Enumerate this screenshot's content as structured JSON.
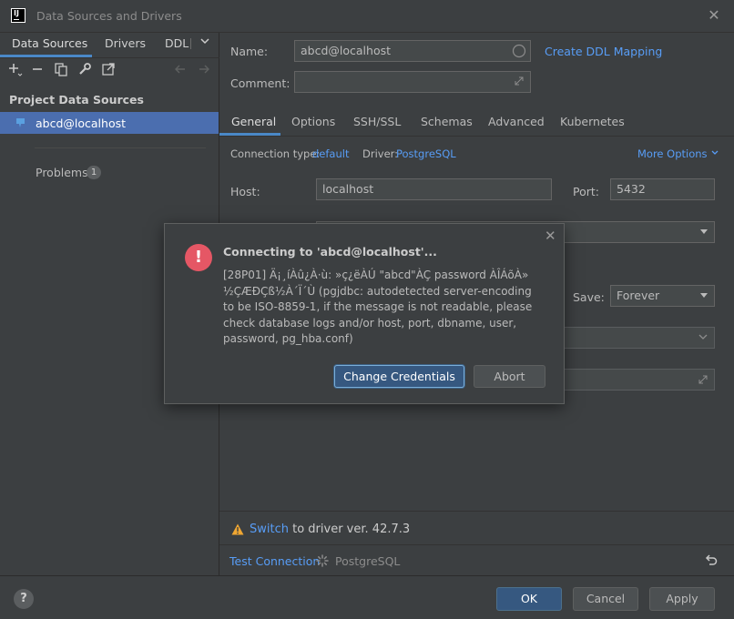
{
  "window": {
    "title": "Data Sources and Drivers"
  },
  "left": {
    "tabs": [
      "Data Sources",
      "Drivers",
      "DDL"
    ],
    "section_header": "Project Data Sources",
    "datasource": "abcd@localhost",
    "problems_label": "Problems",
    "problems_count": "1"
  },
  "form": {
    "name_label": "Name:",
    "name_value": "abcd@localhost",
    "create_ddl": "Create DDL Mapping",
    "comment_label": "Comment:",
    "tabs": [
      "General",
      "Options",
      "SSH/SSL",
      "Schemas",
      "Advanced",
      "Kubernetes"
    ],
    "conn_type_label": "Connection type:",
    "conn_type_value": "default",
    "driver_label": "Driver:",
    "driver_value": "PostgreSQL",
    "more_options": "More Options",
    "host_label": "Host:",
    "host_value": "localhost",
    "port_label": "Port:",
    "port_value": "5432",
    "save_label": "Save:",
    "save_value": "Forever",
    "switch_link": "Switch",
    "switch_text": "to driver ver. 42.7.3",
    "test_connection": "Test Connection",
    "test_status": "PostgreSQL"
  },
  "modal": {
    "title": "Connecting to 'abcd@localhost'...",
    "message": "[28P01] Ä¡¸íÀû¿À·ù: »ç¿ëÀÚ \"abcd\"ÀÇ password ÀÎÁõÀ» ½ÇÆÐÇß½À´Ï´Ù (pgjdbc: autodetected server-encoding to be ISO-8859-1, if the message is not readable, please check database logs and/or host, port, dbname, user, password, pg_hba.conf)",
    "primary_button": "Change Credentials",
    "secondary_button": "Abort"
  },
  "footer": {
    "help": "?",
    "ok": "OK",
    "cancel": "Cancel",
    "apply": "Apply"
  },
  "colors": {
    "accent": "#4a88c7",
    "link": "#589df6",
    "error": "#e55765",
    "warning": "#f0a732",
    "selection": "#4b6eaf"
  }
}
